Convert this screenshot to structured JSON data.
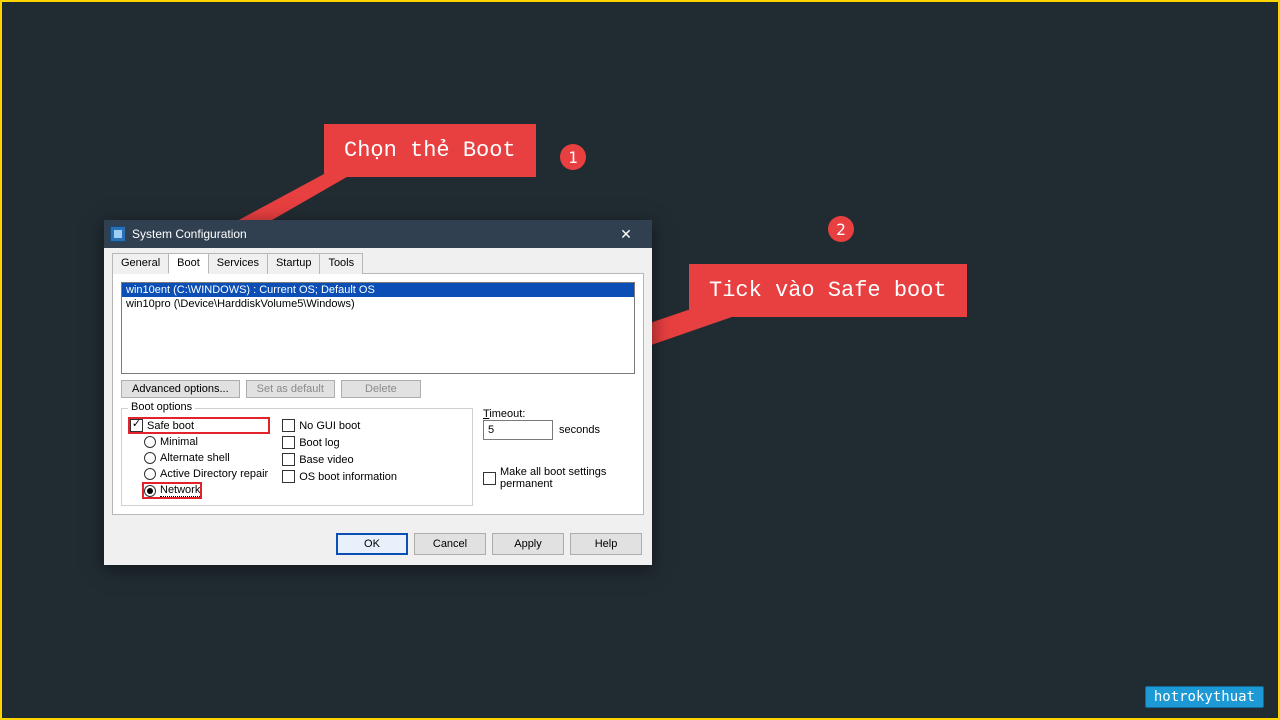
{
  "callouts": {
    "one": {
      "text": "Chọn thẻ Boot",
      "num": "1"
    },
    "two": {
      "text": "Tick vào Safe boot",
      "num": "2"
    }
  },
  "dialog": {
    "title": "System Configuration",
    "tabs": {
      "general": "General",
      "boot": "Boot",
      "services": "Services",
      "startup": "Startup",
      "tools": "Tools"
    },
    "os_list": {
      "row1": "win10ent (C:\\WINDOWS) : Current OS; Default OS",
      "row2": "win10pro (\\Device\\HarddiskVolume5\\Windows)"
    },
    "buttons": {
      "adv": "Advanced options...",
      "setdef": "Set as default",
      "delete": "Delete"
    },
    "boot_options": {
      "legend": "Boot options",
      "safe_boot": "Safe boot",
      "minimal": "Minimal",
      "alternate": "Alternate shell",
      "ad_repair": "Active Directory repair",
      "network": "Network",
      "no_gui": "No GUI boot",
      "boot_log": "Boot log",
      "base_video": "Base video",
      "os_info": "OS boot information"
    },
    "timeout": {
      "label": "Timeout:",
      "value": "5",
      "unit": "seconds"
    },
    "permanent": "Make all boot settings permanent",
    "footer": {
      "ok": "OK",
      "cancel": "Cancel",
      "apply": "Apply",
      "help": "Help"
    }
  },
  "watermark": "hotrokythuat"
}
